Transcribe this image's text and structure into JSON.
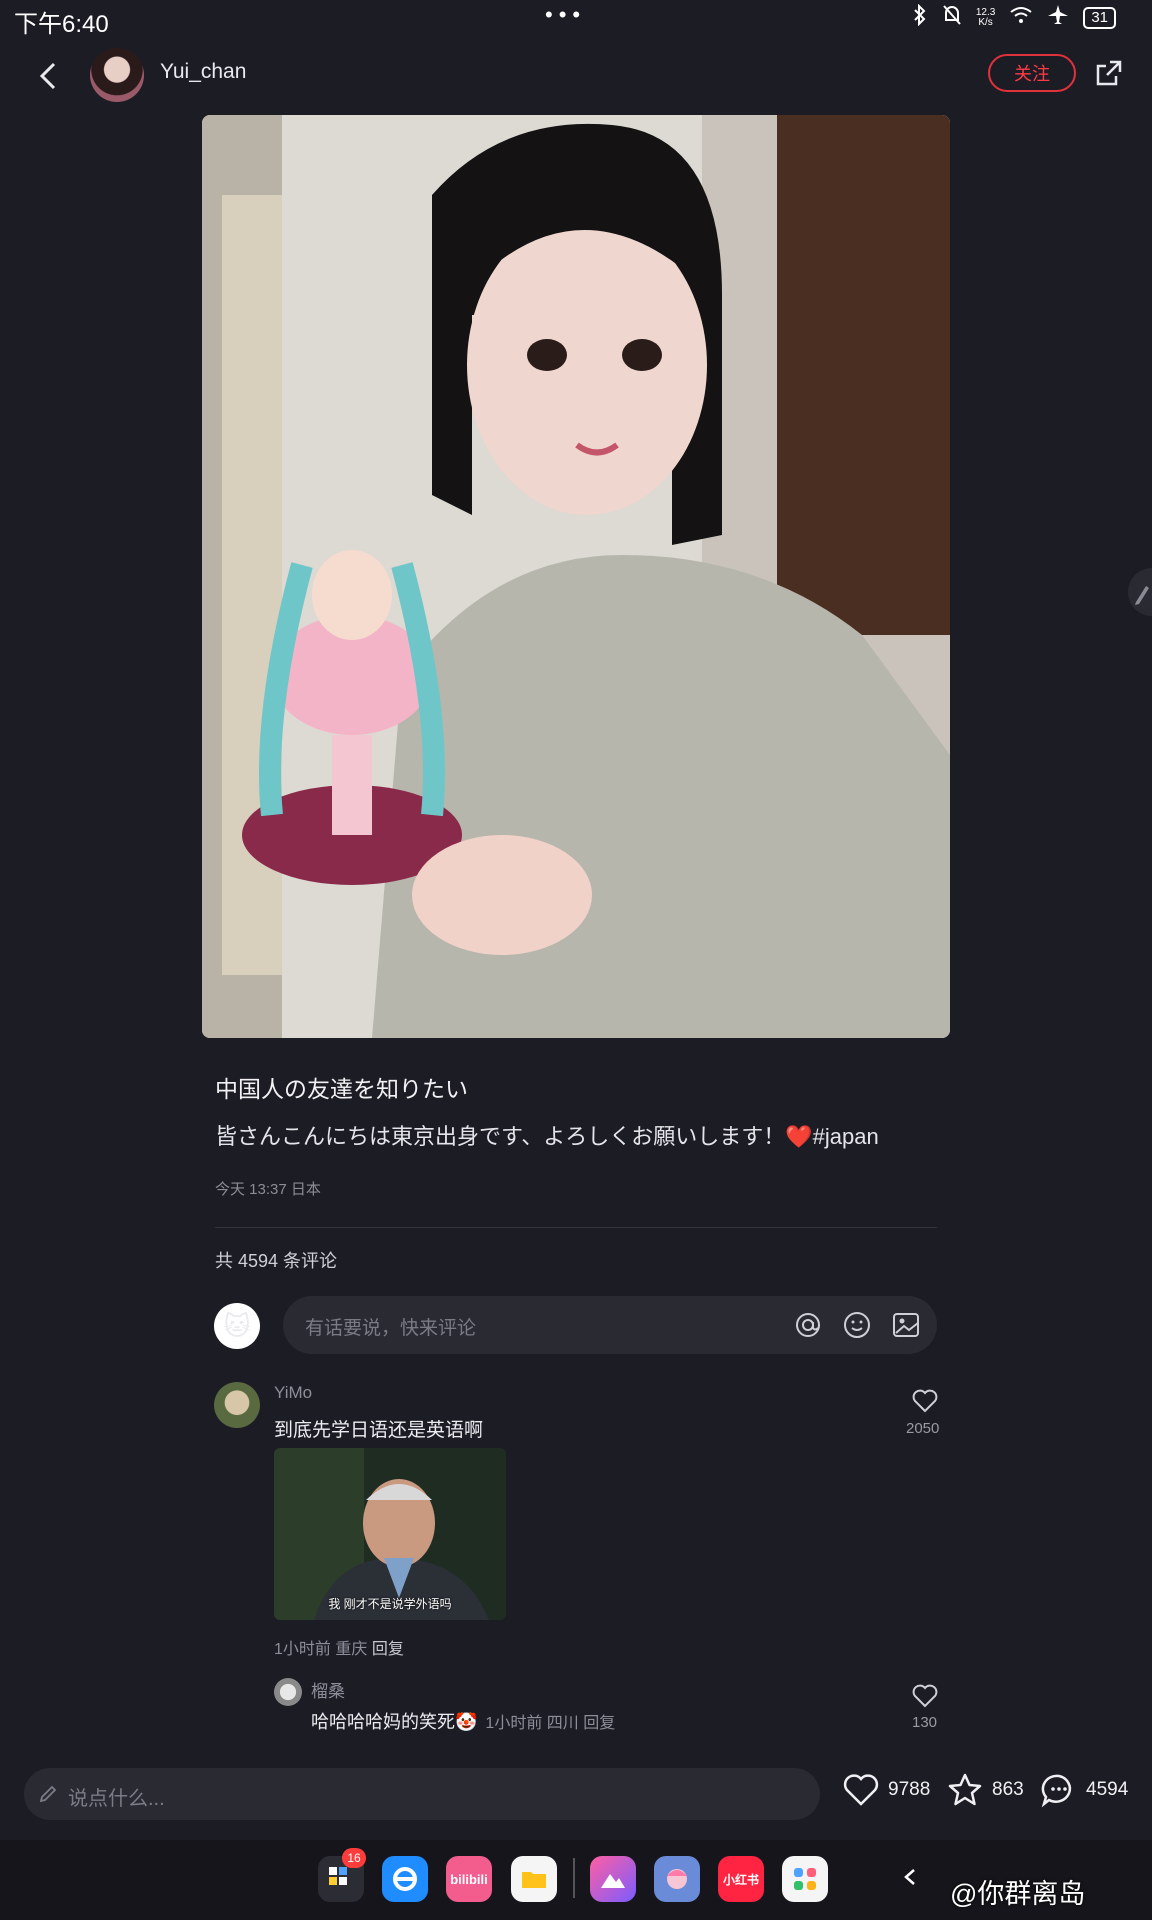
{
  "status_bar": {
    "time": "下午6:40",
    "dots": "•••",
    "net_speed_top": "12.3",
    "net_speed_bottom": "K/s",
    "battery": "31"
  },
  "header": {
    "user_name": "Yui_chan",
    "follow_label": "关注"
  },
  "post": {
    "title": "中国人の友達を知りたい",
    "body": "皆さんこんにちは東京出身です、よろしくお願いします！❤️#japan",
    "meta": "今天 13:37 日本",
    "comment_count": "共 4594 条评论"
  },
  "comment_input": {
    "placeholder": "有话要说，快来评论",
    "avatar_emoji": "🐱"
  },
  "comments": [
    {
      "user": "YiMo",
      "text": "到底先学日语还是英语啊",
      "likes": "2050",
      "image_caption": "我 刚才不是说学外语吗",
      "meta": "1小时前  重庆",
      "reply_label": "回复"
    }
  ],
  "replies": [
    {
      "user": "榴桑",
      "text": "哈哈哈哈妈的笑死🤡",
      "meta": "1小时前  四川  回复",
      "likes": "130"
    }
  ],
  "bottom_bar": {
    "placeholder": "说点什么...",
    "likes": "9788",
    "stars": "863",
    "comments": "4594"
  },
  "dock": {
    "badge": "16",
    "apps": [
      "launcher",
      "browser",
      "bilibili",
      "files",
      "gallery",
      "anime-app",
      "小红书",
      "app-store"
    ],
    "bilibili_label": "bilibili",
    "xhs_label": "小红书"
  },
  "watermark": "@你群离岛"
}
